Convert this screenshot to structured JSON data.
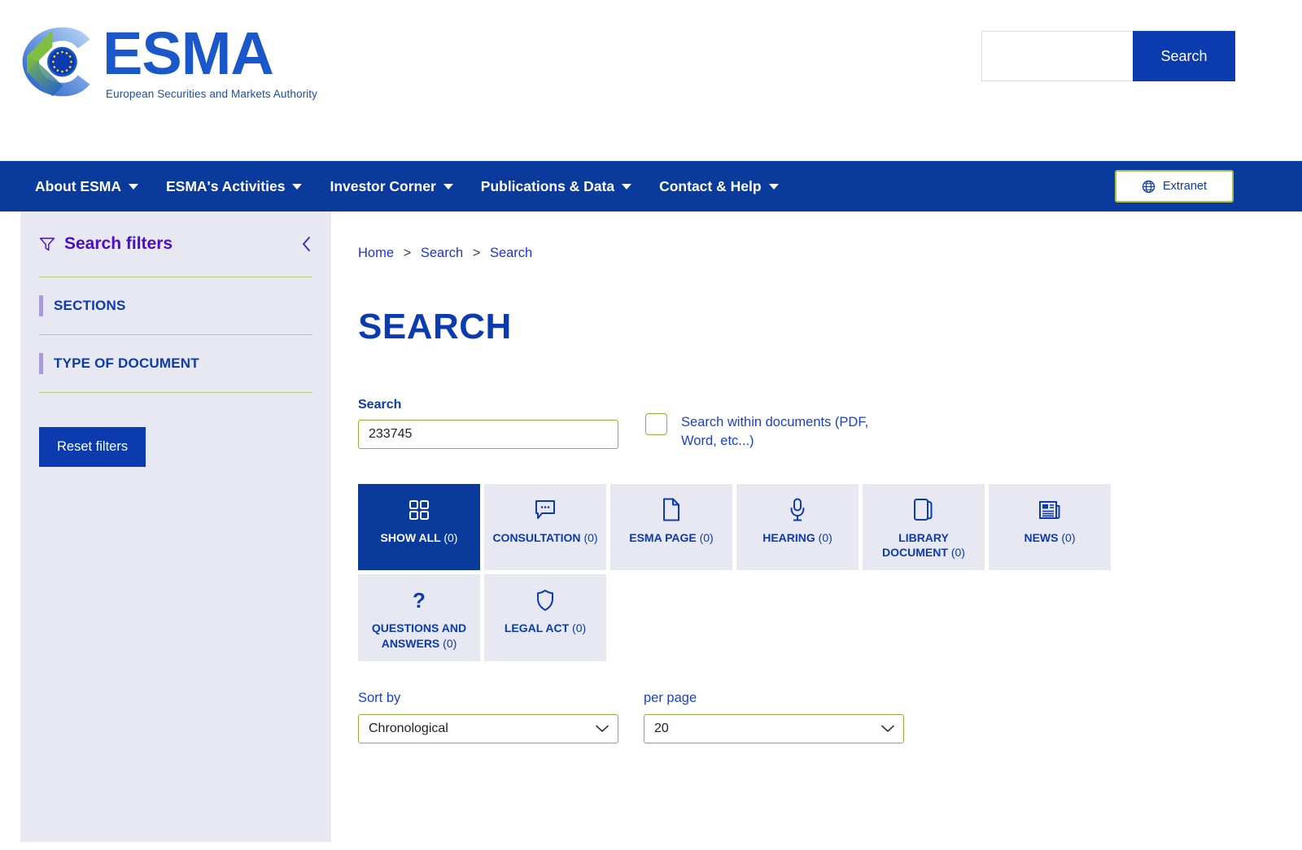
{
  "header": {
    "logo_title": "ESMA",
    "logo_subtitle": "European Securities and Markets Authority",
    "logo_icon": "esma-eye-logo",
    "search": {
      "value": "",
      "placeholder": "",
      "button_label": "Search"
    }
  },
  "nav": {
    "items": [
      {
        "label": "About ESMA",
        "icon": "chevron-down-icon"
      },
      {
        "label": "ESMA's Activities",
        "icon": "chevron-down-icon"
      },
      {
        "label": "Investor Corner",
        "icon": "chevron-down-icon"
      },
      {
        "label": "Publications & Data",
        "icon": "chevron-down-icon"
      },
      {
        "label": "Contact & Help",
        "icon": "chevron-down-icon"
      }
    ],
    "extranet": {
      "label": "Extranet",
      "icon": "globe-icon"
    }
  },
  "sidebar": {
    "title": "Search filters",
    "filter_icon": "funnel-icon",
    "collapse_icon": "chevron-left-icon",
    "groups": [
      {
        "label": "SECTIONS"
      },
      {
        "label": "TYPE OF DOCUMENT"
      }
    ],
    "reset_label": "Reset filters"
  },
  "breadcrumb": {
    "items": [
      "Home",
      "Search",
      "Search"
    ],
    "separator": ">"
  },
  "main": {
    "page_title": "SEARCH",
    "search_label": "Search",
    "search_value": "233745",
    "search_placeholder": "",
    "within_docs_label": "Search within documents (PDF, Word, etc...)",
    "within_docs_checked": false,
    "tabs": [
      {
        "label": "SHOW ALL",
        "count": "(0)",
        "icon": "grid-icon",
        "active": true
      },
      {
        "label": "CONSULTATION",
        "count": "(0)",
        "icon": "chat-bubble-icon",
        "active": false
      },
      {
        "label": "ESMA PAGE",
        "count": "(0)",
        "icon": "document-icon",
        "active": false
      },
      {
        "label": "HEARING",
        "count": "(0)",
        "icon": "microphone-icon",
        "active": false
      },
      {
        "label": "LIBRARY DOCUMENT",
        "count": "(0)",
        "icon": "book-icon",
        "active": false
      },
      {
        "label": "NEWS",
        "count": "(0)",
        "icon": "newspaper-icon",
        "active": false
      },
      {
        "label": "QUESTIONS AND ANSWERS",
        "count": "(0)",
        "icon": "question-mark-icon",
        "active": false
      },
      {
        "label": "LEGAL ACT",
        "count": "(0)",
        "icon": "shield-icon",
        "active": false
      }
    ],
    "sort": {
      "label": "Sort by",
      "value": "Chronological",
      "icon": "chevron-down-icon"
    },
    "per_page": {
      "label": "per page",
      "value": "20",
      "icon": "chevron-down-icon"
    }
  },
  "colors": {
    "brand_blue": "#093a9c",
    "link_blue": "#1a34d8",
    "accent_green": "#8cb33a",
    "sidebar_bg": "#e7e8f2",
    "filter_purple": "#4b0dc8",
    "group_accent": "#a99ad8"
  }
}
